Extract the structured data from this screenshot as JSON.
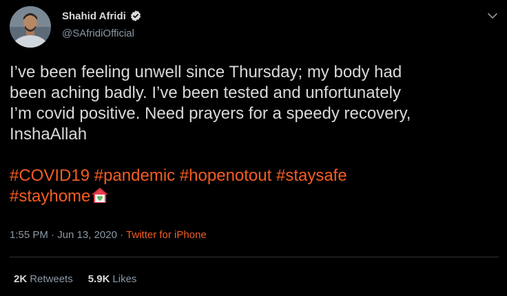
{
  "author": {
    "display_name": "Shahid Afridi",
    "handle": "@SAfridiOfficial",
    "verified": true
  },
  "tweet": {
    "text_lines": [
      "I’ve been feeling unwell since Thursday; my body had",
      "been aching badly. I’ve been tested and unfortunately",
      "I’m covid positive. Need prayers for a speedy recovery,",
      "InshaAllah"
    ],
    "hashtags": [
      "#COVID19",
      "#pandemic",
      "#hopenotout",
      "#staysafe",
      "#stayhome"
    ],
    "emoji": "house-with-heart"
  },
  "meta": {
    "time": "1:55 PM",
    "separator": "·",
    "date": "Jun 13, 2020",
    "source": "Twitter for iPhone"
  },
  "stats": {
    "retweets_count": "2K",
    "retweets_label": "Retweets",
    "likes_count": "5.9K",
    "likes_label": "Likes"
  },
  "colors": {
    "background": "#000000",
    "text": "#d9d9d9",
    "secondary": "#8b98a5",
    "accent": "#f45d22",
    "divider": "#2f3336"
  },
  "icons": {
    "verified": "verified-badge-icon",
    "menu": "chevron-down-icon"
  }
}
